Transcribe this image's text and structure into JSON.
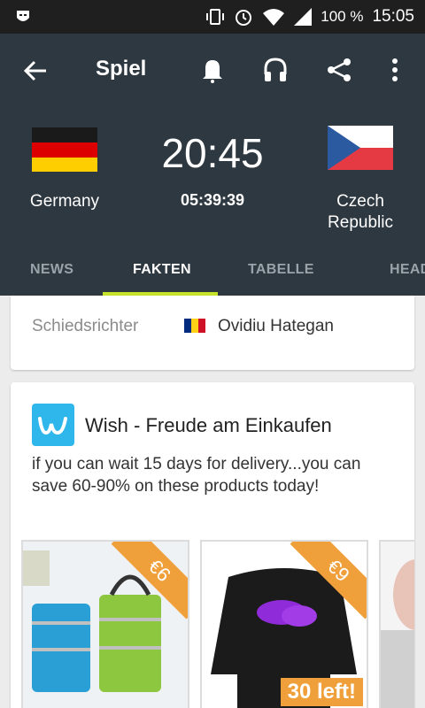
{
  "status_bar": {
    "battery": "100 %",
    "time": "15:05"
  },
  "toolbar": {
    "title": "Spiel"
  },
  "match": {
    "home_team": "Germany",
    "away_team": "Czech Republic",
    "kickoff": "20:45",
    "countdown": "05:39:39"
  },
  "tabs": [
    {
      "label": "NEWS",
      "active": false
    },
    {
      "label": "FAKTEN",
      "active": true
    },
    {
      "label": "TABELLE",
      "active": false
    },
    {
      "label": "HEAD",
      "active": false
    }
  ],
  "facts": {
    "referee_label": "Schiedsrichter",
    "referee_name": "Ovidiu Hategan"
  },
  "ad": {
    "title": "Wish - Freude am Einkaufen",
    "description": "if you can wait 15 days for delivery...you can save 60-90% on these products today!",
    "products": [
      {
        "price": "€6"
      },
      {
        "price": "€9",
        "badge": "30 left!"
      }
    ]
  },
  "colors": {
    "header_bg": "#2e3840",
    "tab_indicator": "#c6e32a",
    "wish_blue": "#2fb7ec",
    "badge_orange": "#f0a03a"
  }
}
